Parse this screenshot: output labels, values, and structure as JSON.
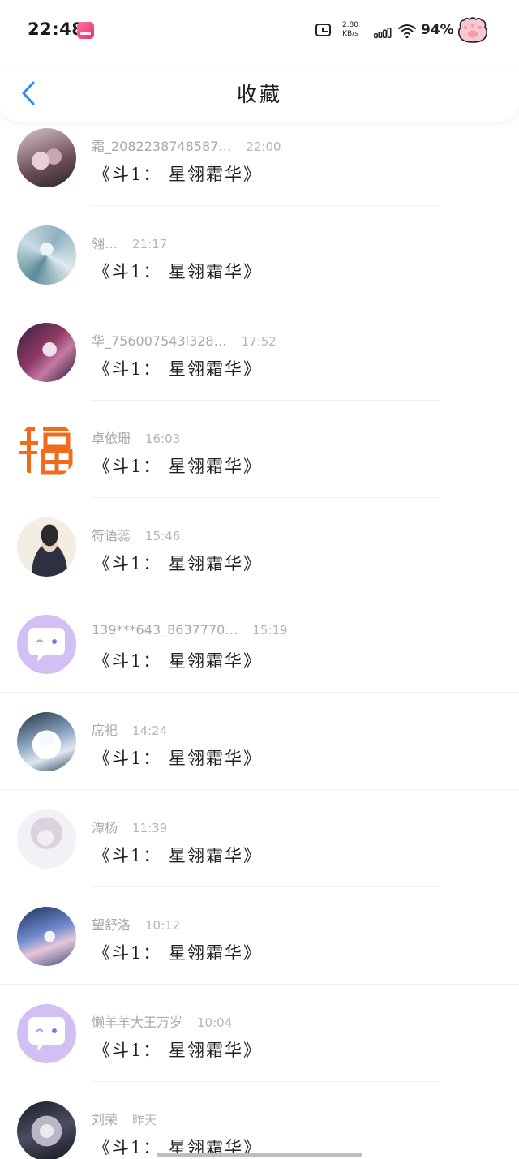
{
  "status_bar": {
    "time": "22:48",
    "net_speed_value": "2.80",
    "net_speed_unit": "KB/s",
    "battery": "94%"
  },
  "nav": {
    "title": "收藏"
  },
  "items": [
    {
      "name": "霜_2082238748587…",
      "time": "22:00",
      "message": "《斗1： 星翎霜华》",
      "avatar_color": "#a9858d"
    },
    {
      "name": "翎…",
      "time": "21:17",
      "message": "《斗1： 星翎霜华》",
      "avatar_color": "#9bbac6"
    },
    {
      "name": "华_756007543l328…",
      "time": "17:52",
      "message": "《斗1： 星翎霜华》",
      "avatar_color": "#8c3a63"
    },
    {
      "name": "卓依珊",
      "time": "16:03",
      "message": "《斗1： 星翎霜华》",
      "avatar_color": "#f26b1d"
    },
    {
      "name": "符语蕊",
      "time": "15:46",
      "message": "《斗1： 星翎霜华》",
      "avatar_color": "#f3ede3"
    },
    {
      "name": "139***643_8637770…",
      "time": "15:19",
      "message": "《斗1： 星翎霜华》",
      "avatar_color": "#d2bff3"
    },
    {
      "name": "席祀",
      "time": "14:24",
      "message": "《斗1： 星翎霜华》",
      "avatar_color": "#8aa3be"
    },
    {
      "name": "潭杨",
      "time": "11:39",
      "message": "《斗1： 星翎霜华》",
      "avatar_color": "#d9d3e0"
    },
    {
      "name": "望舒洛",
      "time": "10:12",
      "message": "《斗1： 星翎霜华》",
      "avatar_color": "#6e8ccf"
    },
    {
      "name": "懒羊羊大王万岁",
      "time": "10:04",
      "message": "《斗1： 星翎霜华》",
      "avatar_color": "#d2bff3"
    },
    {
      "name": "刘荣",
      "time": "昨天",
      "message": "《斗1： 星翎霜华》",
      "avatar_color": "#4a4d61"
    }
  ]
}
